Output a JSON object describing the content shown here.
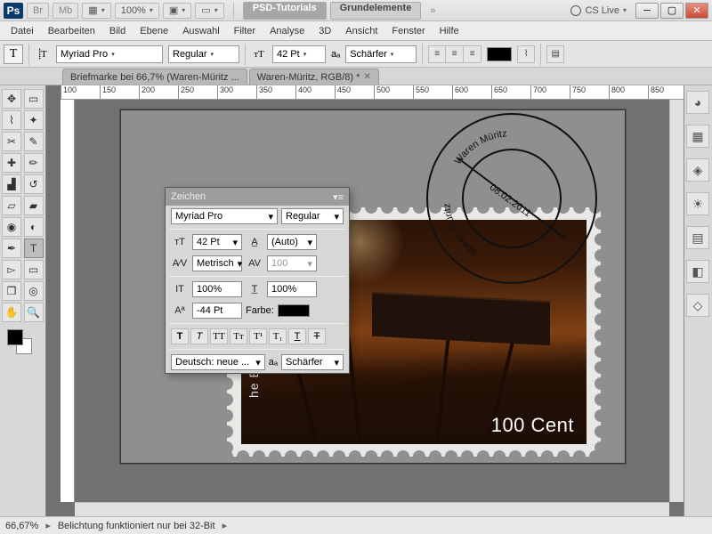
{
  "app": {
    "logo": "Ps"
  },
  "titlebar": {
    "br": "Br",
    "mb": "Mb",
    "zoom": "100%",
    "tabs": {
      "active": "PSD-Tutorials",
      "inactive": "Grundelemente"
    },
    "cslive": "CS Live"
  },
  "menus": [
    "Datei",
    "Bearbeiten",
    "Bild",
    "Ebene",
    "Auswahl",
    "Filter",
    "Analyse",
    "3D",
    "Ansicht",
    "Fenster",
    "Hilfe"
  ],
  "options": {
    "font": "Myriad Pro",
    "style": "Regular",
    "size": "42 Pt",
    "aa_label": "aₐ",
    "aa": "Schärfer"
  },
  "doctabs": [
    "Briefmarke bei 66,7% (Waren-Müritz ...",
    "Waren-Müritz, RGB/8) *"
  ],
  "ruler_ticks": [
    "100",
    "150",
    "200",
    "250",
    "300",
    "350",
    "400",
    "450",
    "500",
    "550",
    "600",
    "650",
    "700",
    "750",
    "800",
    "850"
  ],
  "stamp": {
    "value": "100 Cent",
    "side_text": "he Bundespost"
  },
  "postmark": {
    "text_top": "Waren Müritz",
    "text_left": "Waren Müritz",
    "date": "08.02.2011"
  },
  "zeichen": {
    "title": "Zeichen",
    "font": "Myriad Pro",
    "style": "Regular",
    "size": "42 Pt",
    "leading": "(Auto)",
    "kerning": "Metrisch",
    "tracking": "100",
    "vscale": "100%",
    "hscale": "100%",
    "baseline": "-44 Pt",
    "farbe_label": "Farbe:",
    "language": "Deutsch: neue ...",
    "aa": "Schärfer",
    "aa_label": "aₐ"
  },
  "status": {
    "zoom": "66,67%",
    "msg": "Belichtung funktioniert nur bei 32-Bit"
  }
}
